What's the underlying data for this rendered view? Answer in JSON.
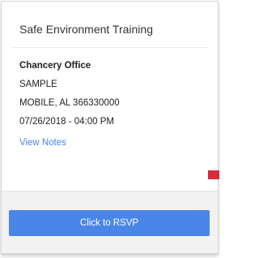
{
  "event": {
    "title": "Safe Environment Training",
    "location": "Chancery Office",
    "address_line": "SAMPLE",
    "city_state_zip": "MOBILE, AL 366330000",
    "datetime": "07/26/2018 - 04:00 PM",
    "view_notes_label": "View Notes"
  },
  "footer": {
    "rsvp_label": "Click to RSVP"
  },
  "colors": {
    "accent": "#4a86e8",
    "marker": "#d42c3a"
  }
}
